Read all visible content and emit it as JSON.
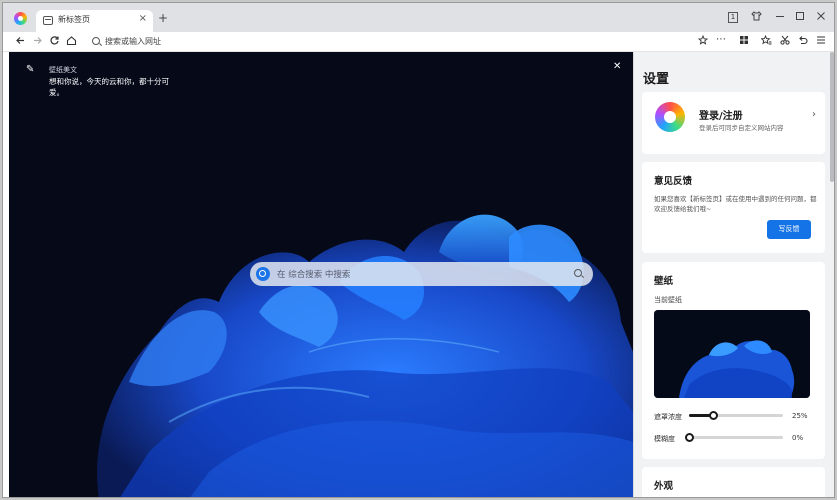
{
  "browser": {
    "tab_title": "新标签页",
    "tab_close": "×",
    "new_tab": "+",
    "address_placeholder": "搜索或输入网址",
    "titlebar_icons": [
      "sidebar-icon",
      "shirt-icon",
      "minimize-icon",
      "maximize-icon",
      "close-icon"
    ],
    "nav_icons": [
      "back-icon",
      "forward-icon",
      "reload-icon",
      "home-icon"
    ],
    "toolbar_icons": [
      "star-icon",
      "more-icon",
      "apps-icon",
      "favorites-icon",
      "scissors-icon",
      "undo-icon",
      "menu-icon"
    ],
    "badge_text": "1"
  },
  "ntp": {
    "quote_source": "壁纸美文",
    "quote_text": "想和你说，今天的云和你，都十分可爱。",
    "search_placeholder": "在 综合搜索 中搜索"
  },
  "settings": {
    "title": "设置",
    "login": {
      "title": "登录/注册",
      "subtitle": "登录后可同步自定义网站内容"
    },
    "feedback": {
      "title": "意见反馈",
      "text": "如果您喜欢【新标签页】或在使用中遇到的任何问题，都欢迎反馈给我们哦~",
      "button": "写反馈"
    },
    "wallpaper": {
      "title": "壁纸",
      "current_label": "当前壁纸",
      "sliders": [
        {
          "label": "遮罩浓度",
          "value_text": "25%",
          "value": 0.25
        },
        {
          "label": "模糊度",
          "value_text": "0%",
          "value": 0
        }
      ]
    },
    "appearance": {
      "title": "外观"
    }
  },
  "colors": {
    "accent": "#1473e6",
    "ntp_background": "#060a1a",
    "panel_background": "#f1f2f4"
  }
}
